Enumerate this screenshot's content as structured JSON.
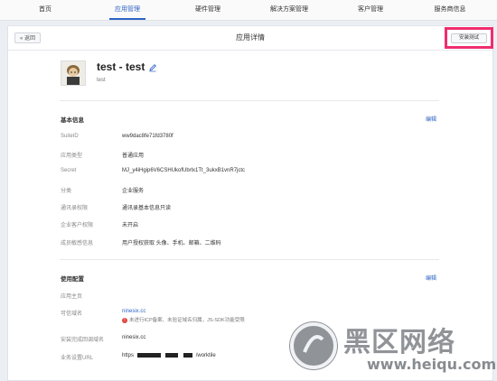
{
  "nav": {
    "items": [
      {
        "label": "首页"
      },
      {
        "label": "应用管理"
      },
      {
        "label": "硬件管理"
      },
      {
        "label": "解决方案管理"
      },
      {
        "label": "客户管理"
      },
      {
        "label": "服务商信息"
      }
    ],
    "active": "应用管理"
  },
  "header": {
    "back_label": "« 返回",
    "title": "应用详情",
    "install_test_label": "安装测试"
  },
  "app": {
    "name": "test - test",
    "subtitle": "test"
  },
  "basic_info": {
    "title": "基本信息",
    "edit_label": "编辑",
    "rows": [
      {
        "label": "SuiteID",
        "value": "ww9dac8fe71fd3780f"
      },
      {
        "label": "应用类型",
        "value": "普通应用"
      },
      {
        "label": "Secret",
        "value": "MJ_y4iHgip6V6CSHUkofUbrlx1Tt_3ukxB1vnR7jctc"
      },
      {
        "label": "分类",
        "value": "企业服务"
      },
      {
        "label": "通讯录权限",
        "value": "通讯录基本信息只读"
      },
      {
        "label": "企业客户权限",
        "value": "未开启"
      },
      {
        "label": "成员敏感信息",
        "value": "用户授权获取 头像、手机、邮箱、二维码"
      }
    ]
  },
  "usage_config": {
    "title": "使用配置",
    "edit_label": "编辑",
    "home_label": "应用主页",
    "trusted_domain_label": "可信域名",
    "trusted_domain_value": "ninesix.cc",
    "trusted_domain_warning": "未进行ICP备案、未验证域名归属，JS-SDK功能受限",
    "callback_domain_label": "安装完成回调域名",
    "callback_domain_value": "ninesix.cc",
    "business_url_label": "业务设置URL",
    "business_url_prefix": "https",
    "business_url_suffix": "/worktile"
  },
  "watermark": {
    "text": "黑区网络",
    "url": "www.heiqu.com"
  }
}
